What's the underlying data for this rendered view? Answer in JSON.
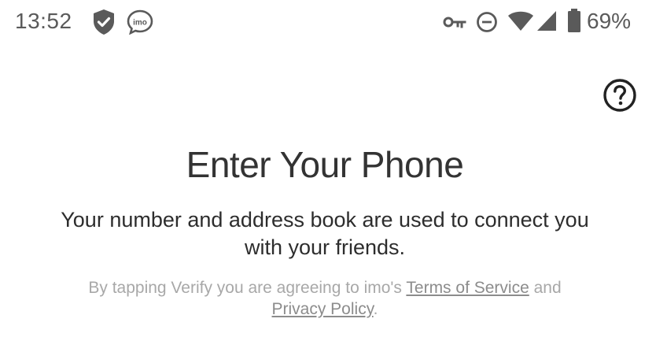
{
  "status_bar": {
    "time": "13:52",
    "battery_percent": "69%",
    "left_icons": [
      "shield-check-icon",
      "imo-app-icon"
    ],
    "right_icons": [
      "vpn-key-icon",
      "do-not-disturb-icon",
      "wifi-icon",
      "cell-signal-icon",
      "battery-icon"
    ],
    "imo_badge": "imo"
  },
  "header": {
    "help_icon": "help-circle-icon"
  },
  "main": {
    "title": "Enter Your Phone",
    "subtitle": "Your number and address book are used to connect you with your friends.",
    "terms": {
      "prefix": "By tapping Verify you are agreeing to imo's ",
      "terms_link": "Terms of Service",
      "middle": " and ",
      "privacy_link": "Privacy Policy",
      "suffix": "."
    }
  },
  "colors": {
    "background": "#ffffff",
    "title_text": "#333333",
    "muted_text": "#a8a8a8",
    "link_text": "#8c8c8c",
    "status_icons": "#5a5a5a"
  }
}
